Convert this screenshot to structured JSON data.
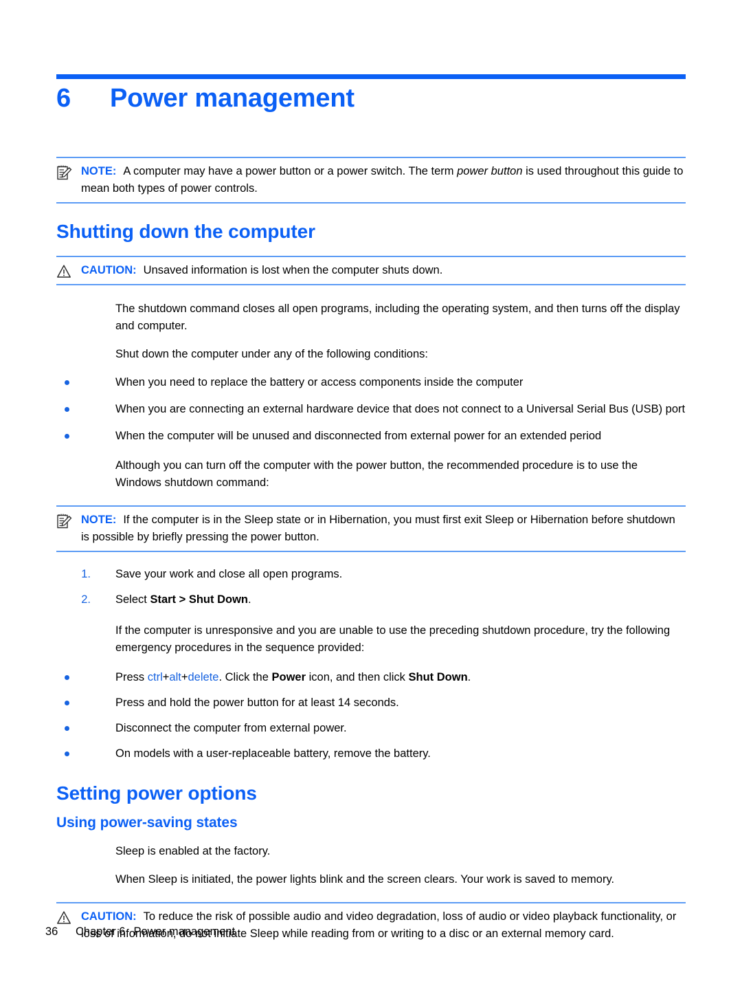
{
  "document": {
    "chapter_number": "6",
    "chapter_title": "Power management",
    "accent_color": "#0b60f5",
    "rule_color": "#5b9bf5",
    "bullet_color": "#1763e0"
  },
  "note_1": {
    "icon": "note-pad-icon",
    "label": "NOTE:",
    "text_part_1": "A computer may have a power button or a power switch. The term ",
    "text_emphasis": "power button",
    "text_part_2": " is used throughout this guide to mean both types of power controls."
  },
  "section_1": {
    "heading": "Shutting down the computer"
  },
  "caution_1": {
    "icon": "warning-triangle-icon",
    "label": "CAUTION:",
    "text": "Unsaved information is lost when the computer shuts down."
  },
  "paragraphs": {
    "p1": "The shutdown command closes all open programs, including the operating system, and then turns off the display and computer.",
    "p2": "Shut down the computer under any of the following conditions:",
    "p3": "Although you can turn off the computer with the power button, the recommended procedure is to use the Windows shutdown command:",
    "p4": "If the computer is unresponsive and you are unable to use the preceding shutdown procedure, try the following emergency procedures in the sequence provided:",
    "p5": "Sleep is enabled at the factory.",
    "p6": "When Sleep is initiated, the power lights blink and the screen clears. Your work is saved to memory."
  },
  "conditions_list": [
    "When you need to replace the battery or access components inside the computer",
    "When you are connecting an external hardware device that does not connect to a Universal Serial Bus (USB) port",
    "When the computer will be unused and disconnected from external power for an extended period"
  ],
  "note_2": {
    "icon": "note-pad-icon",
    "label": "NOTE:",
    "text": "If the computer is in the Sleep state or in Hibernation, you must first exit Sleep or Hibernation before shutdown is possible by briefly pressing the power button."
  },
  "shutdown_steps": [
    {
      "number": "1.",
      "text_part_1": "Save your work and close all open programs.",
      "bold": "",
      "text_part_2": ""
    },
    {
      "number": "2.",
      "text_part_1": "Select ",
      "bold": "Start > Shut Down",
      "text_part_2": "."
    }
  ],
  "emergency_list": {
    "item_1": {
      "prefix": "Press ",
      "key_1": "ctrl",
      "plus_1": "+",
      "key_2": "alt",
      "plus_2": "+",
      "key_3": "delete",
      "middle": ". Click the ",
      "bold_1": "Power",
      "middle_2": " icon, and then click ",
      "bold_2": "Shut Down",
      "suffix": "."
    },
    "item_2": "Press and hold the power button for at least 14 seconds.",
    "item_3": "Disconnect the computer from external power.",
    "item_4": "On models with a user-replaceable battery, remove the battery."
  },
  "section_2": {
    "heading": "Setting power options",
    "subheading": "Using power-saving states"
  },
  "caution_2": {
    "icon": "warning-triangle-icon",
    "label": "CAUTION:",
    "text": "To reduce the risk of possible audio and video degradation, loss of audio or video playback functionality, or loss of information, do not initiate Sleep while reading from or writing to a disc or an external memory card."
  },
  "footer": {
    "page_number": "36",
    "chapter_label": "Chapter 6",
    "chapter_title": "Power management"
  }
}
